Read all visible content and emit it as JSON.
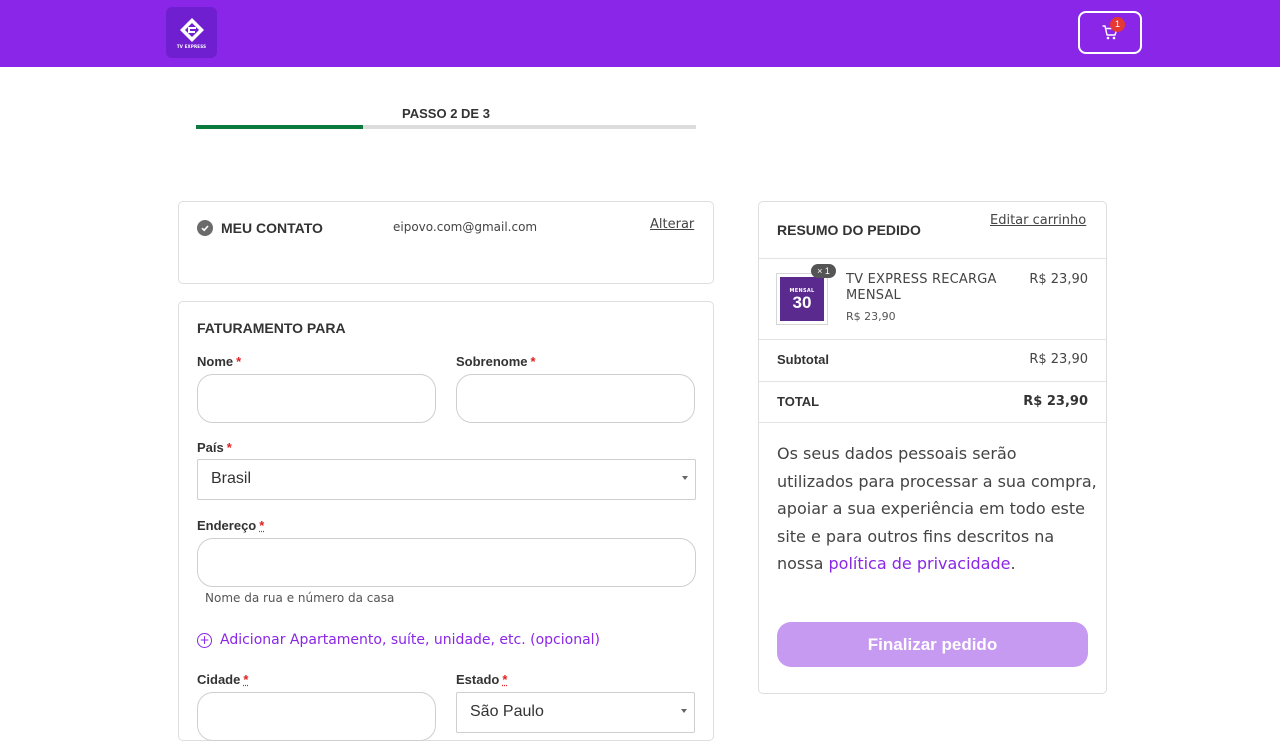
{
  "header": {
    "logo_text": "TV EXPRESS",
    "cart_count": "1",
    "brand_color": "#8a26e8"
  },
  "progress": {
    "step_label": "PASSO 2 DE 3",
    "fraction": 0.333
  },
  "contact": {
    "title": "MEU CONTATO",
    "email": "eipovo.com@gmail.com",
    "change_link": "Alterar"
  },
  "billing": {
    "title": "FATURAMENTO PARA",
    "first_name_label": "Nome",
    "last_name_label": "Sobrenome",
    "country_label": "País",
    "country_value": "Brasil",
    "address_label": "Endereço",
    "address_help": "Nome da rua e número da casa",
    "add_optional": "Adicionar Apartamento, suíte, unidade, etc. (opcional)",
    "city_label": "Cidade",
    "state_label": "Estado",
    "state_value": "São Paulo",
    "required_mark": "*"
  },
  "summary": {
    "title": "RESUMO DO PEDIDO",
    "edit_cart": "Editar carrinho",
    "product": {
      "name": "TV EXPRESS RECARGA MENSAL",
      "unit_price": "R$ 23,90",
      "price": "R$ 23,90",
      "quantity": "× 1",
      "thumb_label": "MENSAL",
      "thumb_number": "30"
    },
    "subtotal_label": "Subtotal",
    "subtotal_value": "R$ 23,90",
    "total_label": "TOTAL",
    "total_value": "R$ 23,90",
    "privacy_text": "Os seus dados pessoais serão utilizados para processar a sua compra, apoiar a sua experiência em todo este site e para outros fins descritos na nossa ",
    "privacy_link": "política de privacidade",
    "privacy_end": ".",
    "finalize_button": "Finalizar pedido"
  }
}
